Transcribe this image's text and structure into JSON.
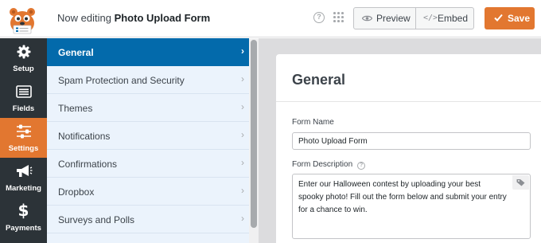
{
  "header": {
    "title_prefix": "Now editing",
    "form_name": "Photo Upload Form",
    "preview_label": "Preview",
    "embed_label": "Embed",
    "save_label": "Save",
    "help_glyph": "?"
  },
  "sidebar": {
    "items": [
      {
        "label": "Setup",
        "icon": "gear-icon"
      },
      {
        "label": "Fields",
        "icon": "fields-icon"
      },
      {
        "label": "Settings",
        "icon": "sliders-icon",
        "active": true
      },
      {
        "label": "Marketing",
        "icon": "megaphone-icon"
      },
      {
        "label": "Payments",
        "icon": "dollar-icon"
      }
    ]
  },
  "submenu": {
    "items": [
      {
        "label": "General",
        "active": true
      },
      {
        "label": "Spam Protection and Security"
      },
      {
        "label": "Themes"
      },
      {
        "label": "Notifications"
      },
      {
        "label": "Confirmations"
      },
      {
        "label": "Dropbox"
      },
      {
        "label": "Surveys and Polls"
      }
    ],
    "chevron": "›"
  },
  "main": {
    "heading": "General",
    "form_name_label": "Form Name",
    "form_name_value": "Photo Upload Form",
    "form_desc_label": "Form Description",
    "form_desc_value": "Enter our Halloween contest by uploading your best spooky photo! Fill out the form below and submit your entry for a chance to win."
  },
  "colors": {
    "accent": "#e27730",
    "active_blue": "#036aab",
    "sidebar_dark": "#2c3338"
  }
}
